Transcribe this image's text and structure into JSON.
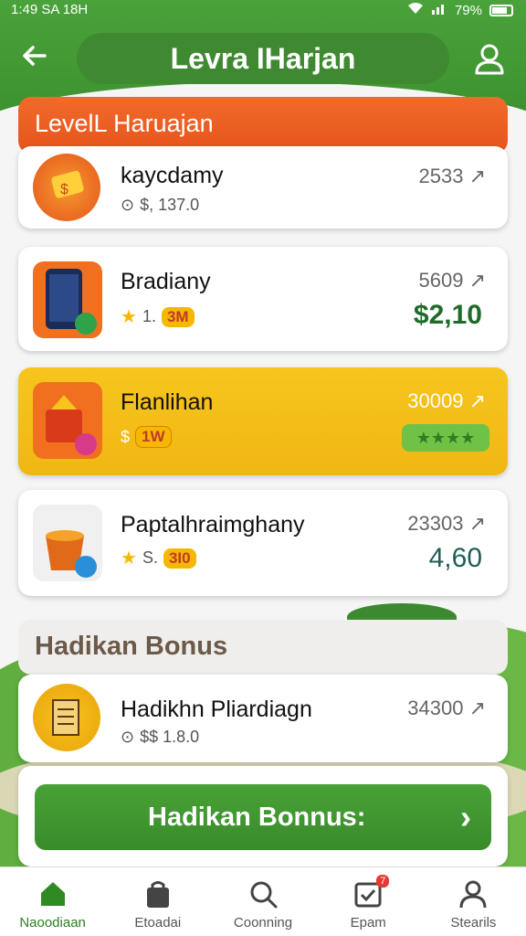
{
  "status_bar": {
    "time": "1:49 SA 18H",
    "battery": "79%"
  },
  "header": {
    "title": "Levra IHarjan"
  },
  "section1": {
    "title": "LevelL Haruajan"
  },
  "items": [
    {
      "name": "kaycdamy",
      "sub": "$, 137.0",
      "score": "2533",
      "value": ""
    },
    {
      "name": "Bradiany",
      "sub": "1.",
      "chip": "3M",
      "score": "5609",
      "value": "$2,10"
    },
    {
      "name": "Flanlihan",
      "sub": "$",
      "chip": "1W",
      "score": "30009",
      "value": ""
    },
    {
      "name": "Paptalhraimghany",
      "sub": "S.",
      "chip": "3I0",
      "score": "23303",
      "value": "4,60"
    }
  ],
  "section2": {
    "title": "Hadikan Bonus"
  },
  "bonus_item": {
    "name": "Hadikhn Pliardiagn",
    "sub": "$$ 1.8.0",
    "score": "34300"
  },
  "bonus_button": {
    "label": "Hadikan Bonnus:"
  },
  "nav": [
    {
      "label": "Naoodiaan",
      "icon": "home-icon"
    },
    {
      "label": "Etoadai",
      "icon": "bag-icon"
    },
    {
      "label": "Coonning",
      "icon": "search-icon"
    },
    {
      "label": "Ераm",
      "icon": "calendar-icon",
      "badge": "7"
    },
    {
      "label": "Stearils",
      "icon": "user-icon"
    }
  ],
  "colors": {
    "primary_green": "#3b8f2e",
    "accent_orange": "#ea5a21",
    "highlight_yellow": "#f4be18"
  }
}
